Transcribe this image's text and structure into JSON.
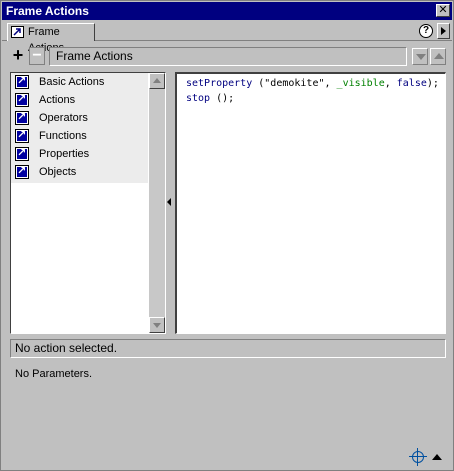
{
  "window": {
    "title": "Frame Actions",
    "close_glyph": "✕"
  },
  "tabs": [
    {
      "label": "Frame Actions",
      "icon": "arrow-book-icon"
    }
  ],
  "tabbar": {
    "help_glyph": "?",
    "menu_icon": "panel-menu-arrow-icon"
  },
  "toolbar": {
    "add_glyph": "+",
    "remove_glyph": "−",
    "current_action_label": "Frame Actions",
    "move_down_icon": "move-down-icon",
    "move_up_icon": "move-up-icon"
  },
  "toolbox": {
    "items": [
      {
        "label": "Basic Actions",
        "icon": "book-icon"
      },
      {
        "label": "Actions",
        "icon": "book-icon"
      },
      {
        "label": "Operators",
        "icon": "book-icon"
      },
      {
        "label": "Functions",
        "icon": "book-icon"
      },
      {
        "label": "Properties",
        "icon": "book-icon"
      },
      {
        "label": "Objects",
        "icon": "book-icon"
      }
    ]
  },
  "code": {
    "line1": {
      "fn": "setProperty",
      "open": " (",
      "arg1": "\"demokite\"",
      "sep1": ", ",
      "arg2": "_visible",
      "sep2": ", ",
      "arg3": "false",
      "close": ");"
    },
    "line2": {
      "fn": "stop",
      "rest": " ();"
    }
  },
  "status": {
    "text": "No action selected.",
    "params_text": "No Parameters."
  },
  "footer": {
    "target_icon": "insert-target-path-icon",
    "collapse_icon": "collapse-parameters-icon"
  },
  "colors": {
    "title_bar": "#000080",
    "keyword": "#000080",
    "property": "#008000"
  }
}
